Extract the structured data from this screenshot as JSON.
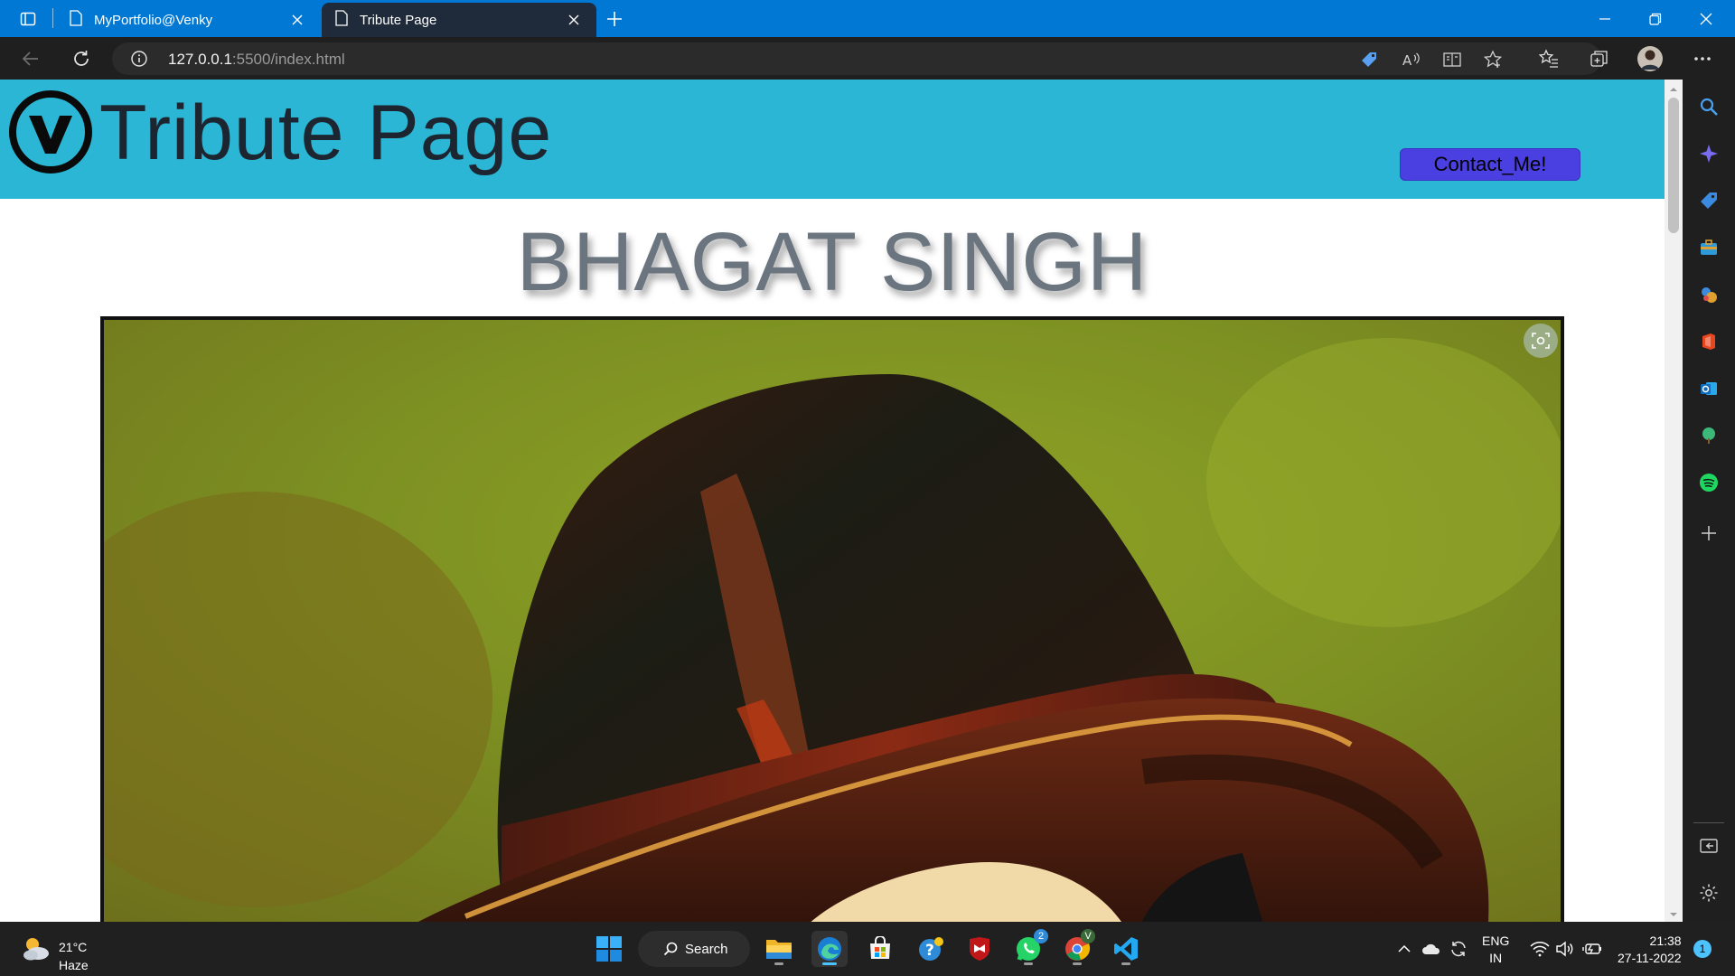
{
  "browser": {
    "tabs": [
      {
        "title": "MyPortfolio@Venky"
      },
      {
        "title": "Tribute Page"
      }
    ],
    "url_host": "127.0.0.1",
    "url_path": ":5500/index.html"
  },
  "page": {
    "header_title": "Tribute Page",
    "contact_button": "Contact_Me!",
    "heading": "BHAGAT SINGH",
    "colors": {
      "header_bg": "#2ab6d4",
      "contact_bg": "#4a3fe0",
      "heading": "#6b7580"
    }
  },
  "taskbar": {
    "weather_temp": "21°C",
    "weather_condition": "Haze",
    "search_label": "Search",
    "lang_line1": "ENG",
    "lang_line2": "IN",
    "time": "21:38",
    "date": "27-11-2022",
    "notification_count": "1",
    "whatsapp_badge": "2"
  }
}
